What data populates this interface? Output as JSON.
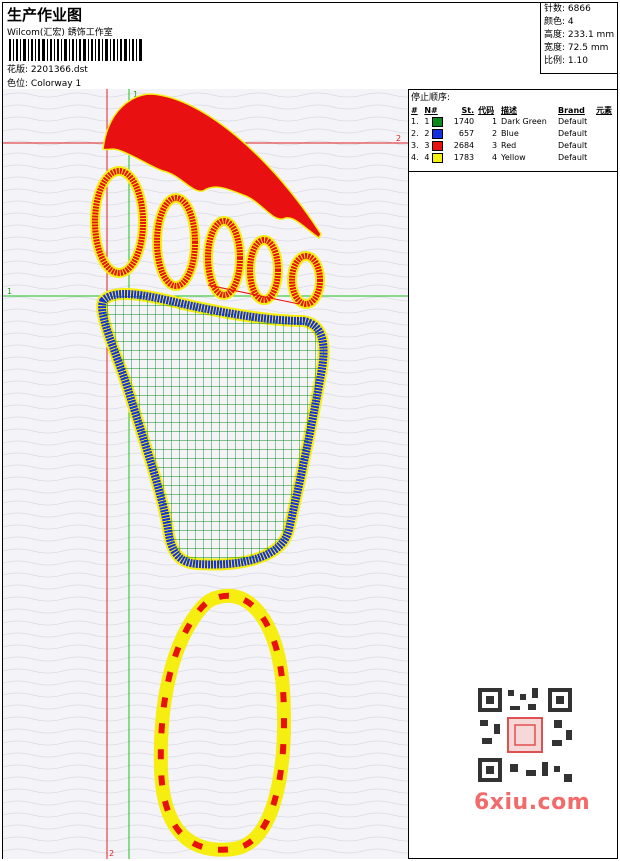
{
  "header": {
    "title": "生产作业图",
    "subtitle": "Wilcom(汇宏) 銹饰工作室",
    "design_label": "花版:",
    "design_file": "2201366.dst",
    "colorway_label": "色位:",
    "colorway": "Colorway 1"
  },
  "specs": [
    {
      "label": "针数:",
      "value": "6866"
    },
    {
      "label": "颜色:",
      "value": "4"
    },
    {
      "label": "高度:",
      "value": "233.1 mm"
    },
    {
      "label": "宽度:",
      "value": "72.5 mm"
    },
    {
      "label": "比例:",
      "value": "1.10"
    }
  ],
  "stop_sequence": {
    "title": "停止顺序:",
    "columns": [
      "#",
      "N#",
      "St.",
      "代码",
      "描述",
      "Brand",
      "元素"
    ],
    "rows": [
      {
        "idx": "1.",
        "n": "1",
        "color": "#0a8a1a",
        "stitches": "1740",
        "code": "1",
        "desc": "Dark Green",
        "brand": "Default"
      },
      {
        "idx": "2.",
        "n": "2",
        "color": "#1530e0",
        "stitches": "657",
        "code": "2",
        "desc": "Blue",
        "brand": "Default"
      },
      {
        "idx": "3.",
        "n": "3",
        "color": "#e81010",
        "stitches": "2684",
        "code": "3",
        "desc": "Red",
        "brand": "Default"
      },
      {
        "idx": "4.",
        "n": "4",
        "color": "#f6ee10",
        "stitches": "1783",
        "code": "4",
        "desc": "Yellow",
        "brand": "Default"
      }
    ]
  },
  "canvas": {
    "guide_labels": [
      "1",
      "2",
      "1",
      "2"
    ],
    "colors": {
      "red": "#e81010",
      "green": "#0a8a1a",
      "blue": "#1530e0",
      "yellow": "#f6ee10",
      "guide_red": "#e02020",
      "guide_green": "#20c020"
    }
  },
  "watermark": {
    "text": "6xiu.com"
  }
}
